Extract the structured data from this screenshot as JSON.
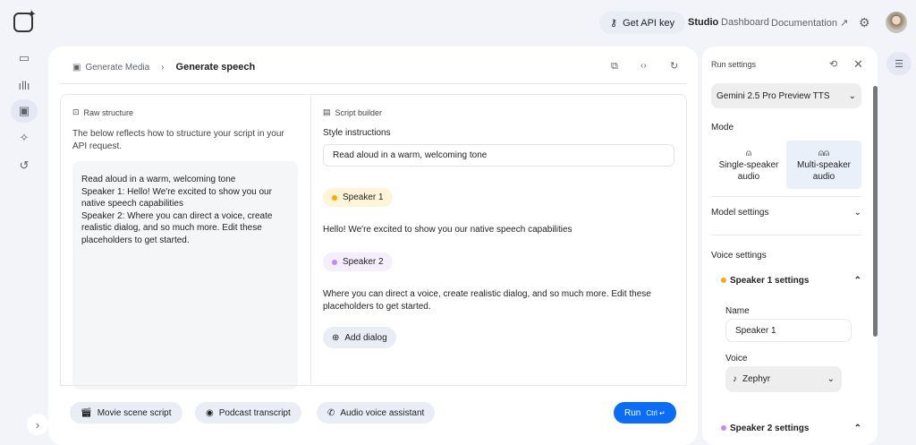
{
  "topbar": {
    "api_key": "Get API key",
    "studio": "Studio",
    "dashboard": "Dashboard",
    "documentation": "Documentation"
  },
  "breadcrumb": {
    "parent": "Generate Media",
    "current": "Generate speech"
  },
  "raw": {
    "title": "Raw structure",
    "desc": "The below reflects how to structure your script in your API request.",
    "lines": [
      "Read aloud in a warm, welcoming tone",
      "Speaker 1: Hello! We're excited to show you our native speech capabilities",
      "Speaker 2: Where you can direct a voice, create realistic dialog, and so much more. Edit these placeholders to get started."
    ]
  },
  "builder": {
    "title": "Script builder",
    "style_label": "Style instructions",
    "style_value": "Read aloud in a warm, welcoming tone",
    "speaker1": "Speaker 1",
    "line1": "Hello! We're excited to show you our native speech capabilities",
    "speaker2": "Speaker 2",
    "line2": "Where you can direct a voice, create realistic dialog, and so much more. Edit these placeholders to get started.",
    "add": "Add dialog"
  },
  "bottom": {
    "movie": "Movie scene script",
    "podcast": "Podcast transcript",
    "assistant": "Audio voice assistant",
    "run": "Run",
    "shortcut": "Ctrl ↵"
  },
  "settings": {
    "title": "Run settings",
    "model": "Gemini 2.5 Pro Preview TTS",
    "mode": "Mode",
    "single": "Single-speaker audio",
    "multi": "Multi-speaker audio",
    "model_settings": "Model settings",
    "voice_settings": "Voice settings",
    "s1_settings": "Speaker 1 settings",
    "name_label": "Name",
    "name_value": "Speaker 1",
    "voice_label": "Voice",
    "voice_value": "Zephyr",
    "s2_settings": "Speaker 2 settings"
  },
  "colors": {
    "accent": "#0b6cf5",
    "speaker1": "#f9ab00",
    "speaker2": "#c58af9"
  }
}
